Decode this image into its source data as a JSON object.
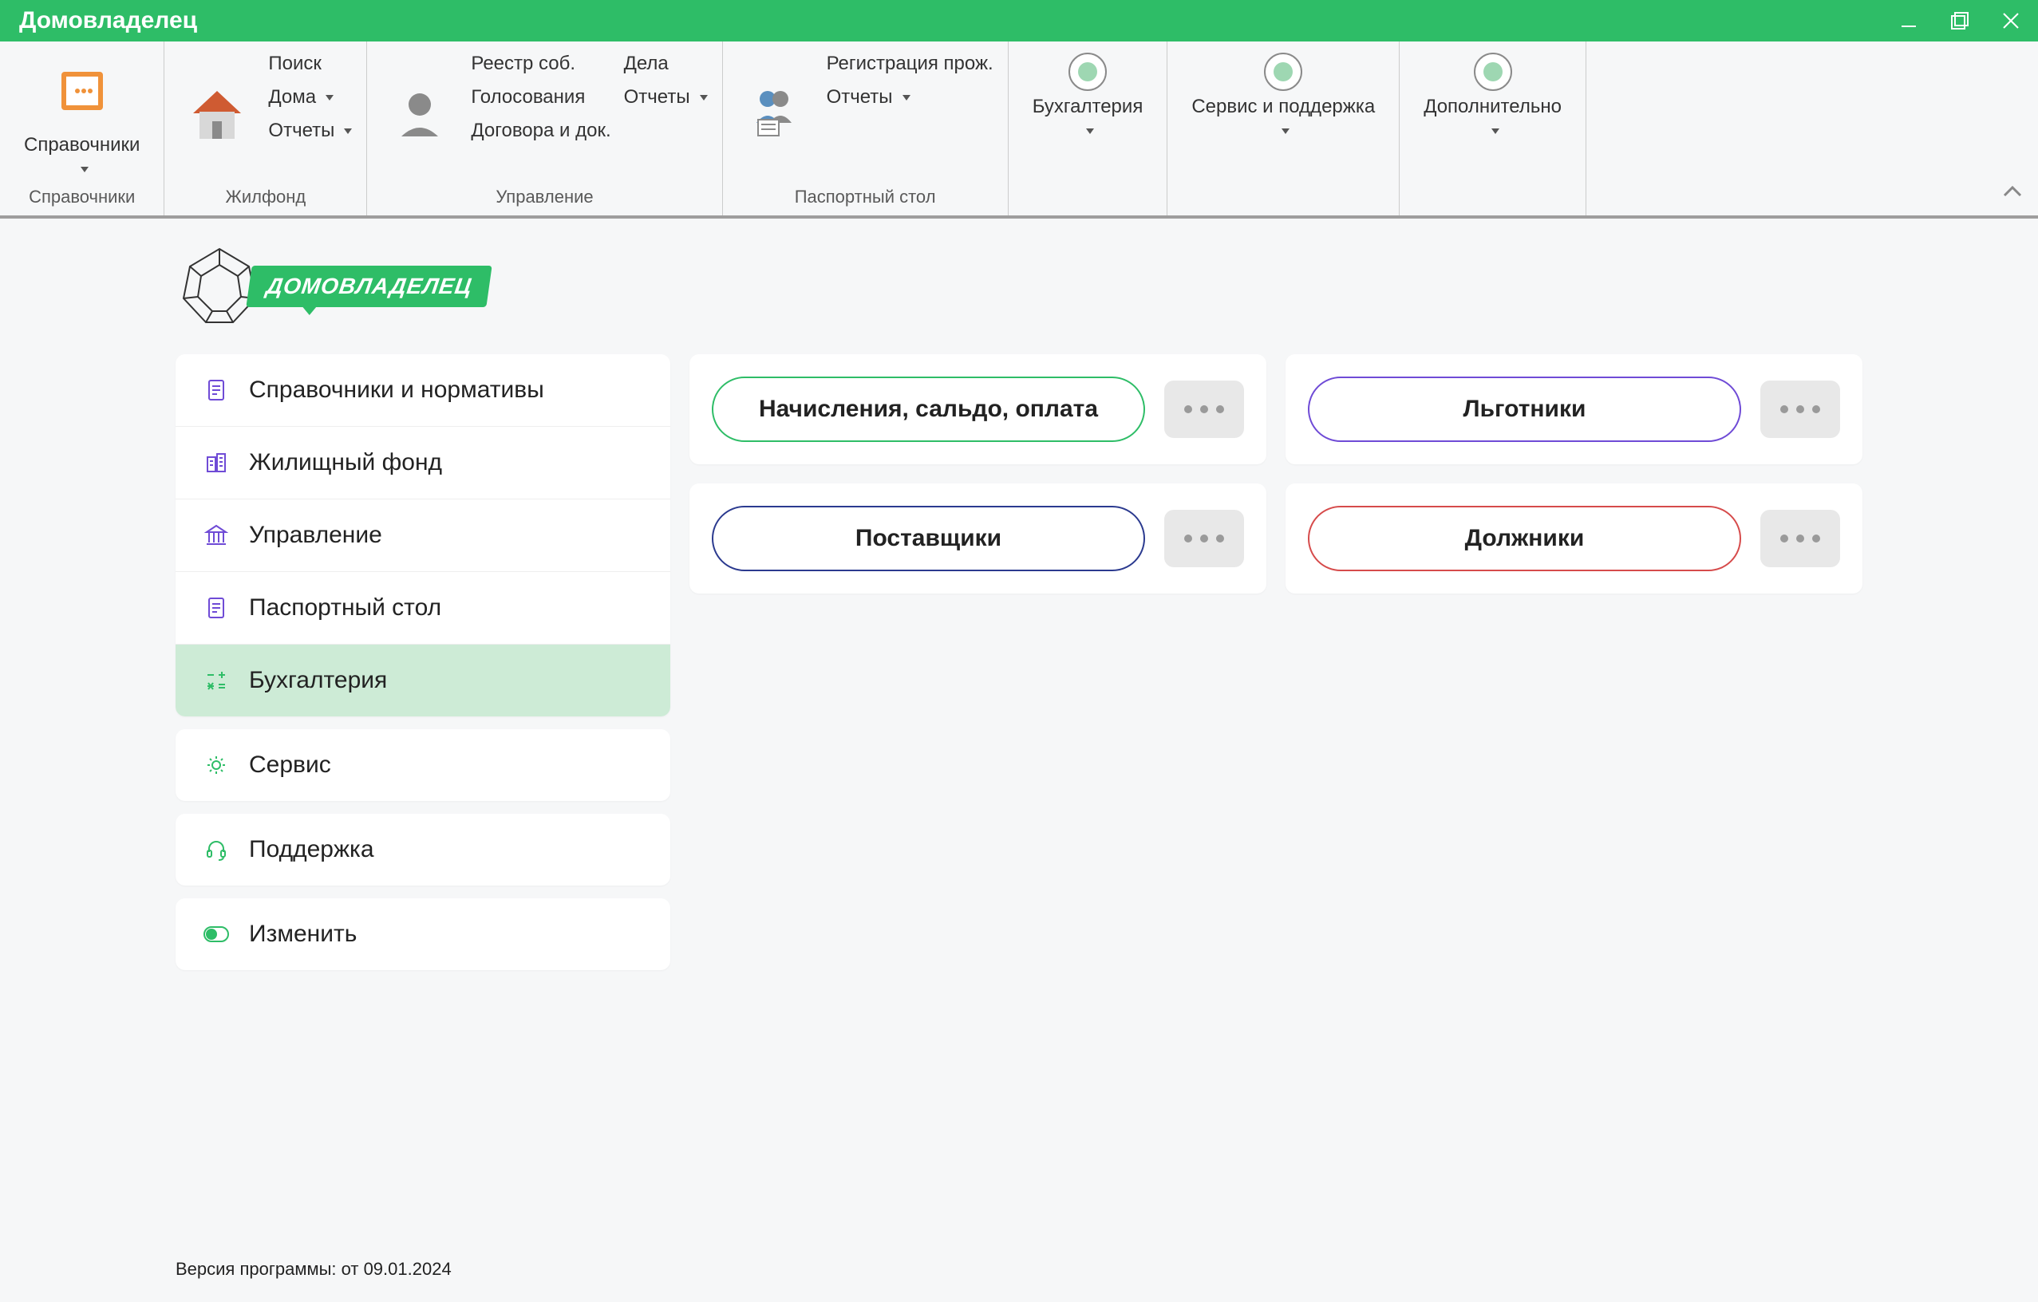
{
  "title": "Домовладелец",
  "ribbon": {
    "groups": [
      {
        "label": "Справочники",
        "big": {
          "label": "Справочники"
        }
      },
      {
        "label": "Жилфонд",
        "items": [
          "Поиск",
          "Дома",
          "Отчеты"
        ],
        "drops": [
          false,
          true,
          true
        ]
      },
      {
        "label": "Управление",
        "cols": [
          {
            "items": [
              "Реестр соб.",
              "Голосования",
              "Договора и док."
            ],
            "drops": [
              false,
              false,
              false
            ]
          },
          {
            "items": [
              "Дела",
              "Отчеты"
            ],
            "drops": [
              false,
              true
            ]
          }
        ]
      },
      {
        "label": "Паспортный стол",
        "items": [
          "Регистрация прож.",
          "Отчеты"
        ],
        "drops": [
          false,
          true
        ]
      },
      {
        "big": {
          "label": "Бухгалтерия"
        }
      },
      {
        "big": {
          "label": "Сервис и поддержка"
        }
      },
      {
        "big": {
          "label": "Дополнительно"
        }
      }
    ]
  },
  "logo_text": "ДОМОВЛАДЕЛЕЦ",
  "sidebar": {
    "groups": [
      {
        "items": [
          {
            "label": "Справочники и нормативы",
            "icon": "doc",
            "color": "#6f4bd6"
          },
          {
            "label": "Жилищный фонд",
            "icon": "buildings",
            "color": "#6f4bd6"
          },
          {
            "label": "Управление",
            "icon": "bank",
            "color": "#6f4bd6"
          },
          {
            "label": "Паспортный стол",
            "icon": "doc",
            "color": "#6f4bd6"
          },
          {
            "label": "Бухгалтерия",
            "icon": "calc",
            "color": "#2ebd67",
            "active": true
          }
        ]
      },
      {
        "items": [
          {
            "label": "Сервис",
            "icon": "gear",
            "color": "#2ebd67"
          }
        ]
      },
      {
        "items": [
          {
            "label": "Поддержка",
            "icon": "headset",
            "color": "#2ebd67"
          }
        ]
      },
      {
        "items": [
          {
            "label": "Изменить",
            "icon": "toggle",
            "color": "#2ebd67"
          }
        ]
      }
    ]
  },
  "tiles": [
    {
      "label": "Начисления, сальдо, оплата",
      "cls": "green"
    },
    {
      "label": "Льготники",
      "cls": "purple"
    },
    {
      "label": "Поставщики",
      "cls": "navy"
    },
    {
      "label": "Должники",
      "cls": "red"
    }
  ],
  "footer": "Версия программы: от 09.01.2024"
}
